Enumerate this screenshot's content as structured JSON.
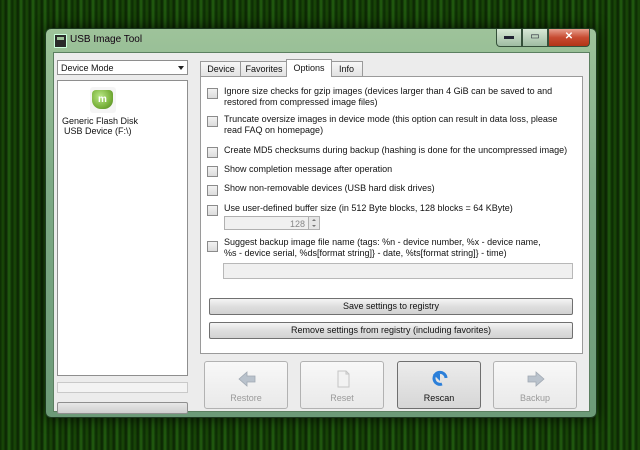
{
  "window": {
    "title": "USB Image Tool",
    "caption_buttons": {
      "minimize": "▬",
      "maximize": "▭",
      "close": "✕"
    }
  },
  "left_panel": {
    "mode_select": {
      "selected": "Device Mode"
    },
    "devices": [
      {
        "icon": "linux-mint-icon",
        "icon_glyph": "m",
        "name": "Generic Flash Disk",
        "subtitle": "USB Device (F:\\)"
      }
    ]
  },
  "tabs": [
    {
      "label": "Device",
      "active": false
    },
    {
      "label": "Favorites",
      "active": false
    },
    {
      "label": "Options",
      "active": true
    },
    {
      "label": "Info",
      "active": false
    }
  ],
  "options": {
    "ignore_size": {
      "line1": "Ignore size checks for gzip images (devices larger than 4 GiB can be saved to and",
      "line2": "restored from compressed image files)",
      "checked": false
    },
    "truncate": {
      "line1": "Truncate oversize images in device mode (this option can result in data loss, please",
      "line2": "read FAQ on homepage)",
      "checked": false
    },
    "md5": {
      "line1": "Create MD5 checksums during backup (hashing is done for the uncompressed image)",
      "checked": false
    },
    "completion_message": {
      "line1": "Show completion message after operation",
      "checked": false
    },
    "non_removable": {
      "line1": "Show non-removable devices (USB hard disk drives)",
      "checked": false
    },
    "buffer_size": {
      "line1": "Use user-defined buffer size (in 512 Byte blocks, 128 blocks = 64 KByte)",
      "checked": false,
      "value": "128"
    },
    "suggest_name": {
      "line1": "Suggest backup image file name (tags: %n - device number, %x - device name,",
      "line2": "%s - device serial, %ds[format string]} - date, %ts[format string]} - time)",
      "checked": false,
      "value": ""
    }
  },
  "buttons": {
    "save_settings": "Save settings to registry",
    "remove_settings": "Remove settings from registry (including favorites)"
  },
  "actions": [
    {
      "label": "Restore",
      "icon": "arrow-left-icon",
      "enabled": false
    },
    {
      "label": "Reset",
      "icon": "document-icon",
      "enabled": false
    },
    {
      "label": "Rescan",
      "icon": "refresh-icon",
      "enabled": true
    },
    {
      "label": "Backup",
      "icon": "arrow-right-icon",
      "enabled": false
    }
  ]
}
